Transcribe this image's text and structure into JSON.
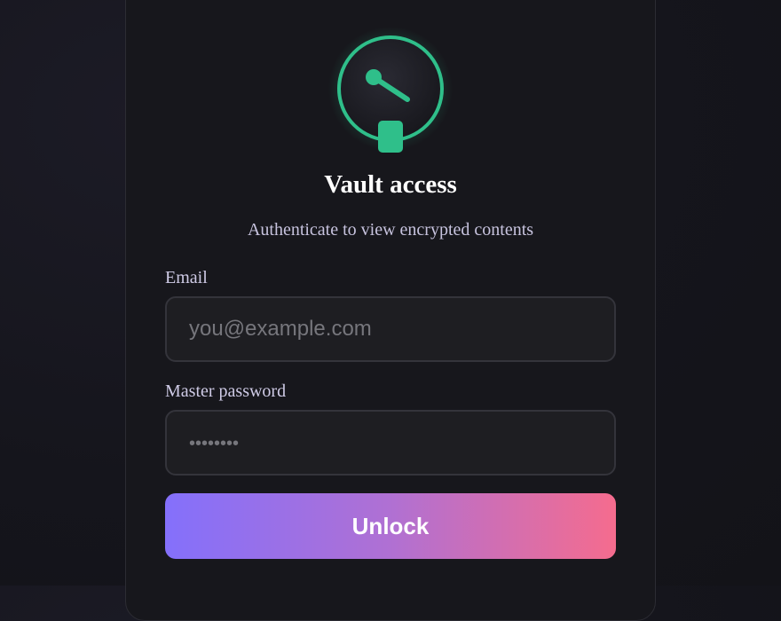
{
  "logo": {
    "icon": "vault-dial-icon",
    "accent_color": "#2fbf8a"
  },
  "header": {
    "title": "Vault access",
    "subtitle": "Authenticate to view encrypted contents"
  },
  "form": {
    "email": {
      "label": "Email",
      "value": "",
      "placeholder": "you@example.com"
    },
    "password": {
      "label": "Master password",
      "value": "",
      "placeholder": "••••••••"
    },
    "submit_label": "Unlock"
  },
  "colors": {
    "background": "#15151c",
    "card": "#17171c",
    "button_gradient_start": "#8470fb",
    "button_gradient_end": "#f56c8e"
  }
}
